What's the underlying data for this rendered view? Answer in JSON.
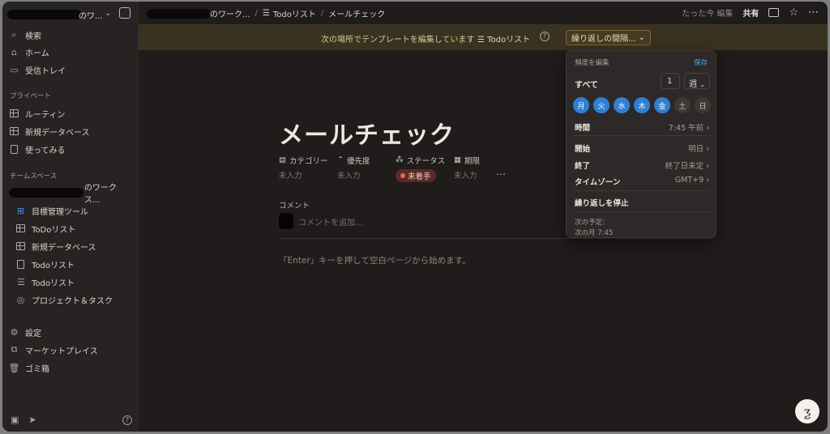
{
  "sidebar": {
    "workspace_name": "のワ...",
    "nav": [
      "検索",
      "ホーム",
      "受信トレイ"
    ],
    "private_label": "プライベート",
    "private_items": [
      "ルーティン",
      "新規データベース",
      "使ってみる"
    ],
    "team_label": "チームスペース",
    "team_ws_name": "のワークス...",
    "team_items": [
      "目標管理ツール",
      "ToDoリスト",
      "新規データベース",
      "Todoリスト",
      "Todoリスト",
      "プロジェクト＆タスク"
    ],
    "footer_items": [
      "設定",
      "マーケットプレイス",
      "ゴミ箱"
    ],
    "help_icon": "?"
  },
  "topbar": {
    "crumb1": "のワーク...",
    "crumb2": "Todoリスト",
    "crumb3": "メールチェック",
    "edited": "たった今 編集",
    "share": "共有"
  },
  "banner": {
    "text": "次の場所でテンプレートを編集しています",
    "db_name": "Todoリスト",
    "repeat_button": "繰り返しの間隔..."
  },
  "page": {
    "title": "メールチェック",
    "properties": [
      {
        "name": "カテゴリー",
        "value": "未入力"
      },
      {
        "name": "優先度",
        "value": "未入力"
      },
      {
        "name": "ステータス",
        "value": "未着手"
      },
      {
        "name": "期限",
        "value": "未入力"
      }
    ],
    "comment_label": "コメント",
    "comment_placeholder": "コメントを追加...",
    "enter_hint": "「Enter」キーを押して空白ページから始めます。"
  },
  "popover": {
    "header": "頻度を編集",
    "save": "保存",
    "every_label": "すべて",
    "interval": "1",
    "unit": "週",
    "days": [
      {
        "label": "月",
        "on": true
      },
      {
        "label": "火",
        "on": true
      },
      {
        "label": "水",
        "on": true
      },
      {
        "label": "木",
        "on": true
      },
      {
        "label": "金",
        "on": true
      },
      {
        "label": "土",
        "on": false
      },
      {
        "label": "日",
        "on": false
      }
    ],
    "time_label": "時間",
    "time_value": "7:45 午前",
    "start_label": "開始",
    "start_value": "明日",
    "end_label": "終了",
    "end_value": "終了日未定",
    "tz_label": "タイムゾーン",
    "tz_value": "GMT+9",
    "stop_label": "繰り返しを停止",
    "next_label": "次の予定：",
    "next_value": "次の月 7:45"
  },
  "colors": {
    "accent_blue": "#2f7fd3",
    "banner_bg": "#3a3220",
    "status_bg": "#5b2a27"
  }
}
